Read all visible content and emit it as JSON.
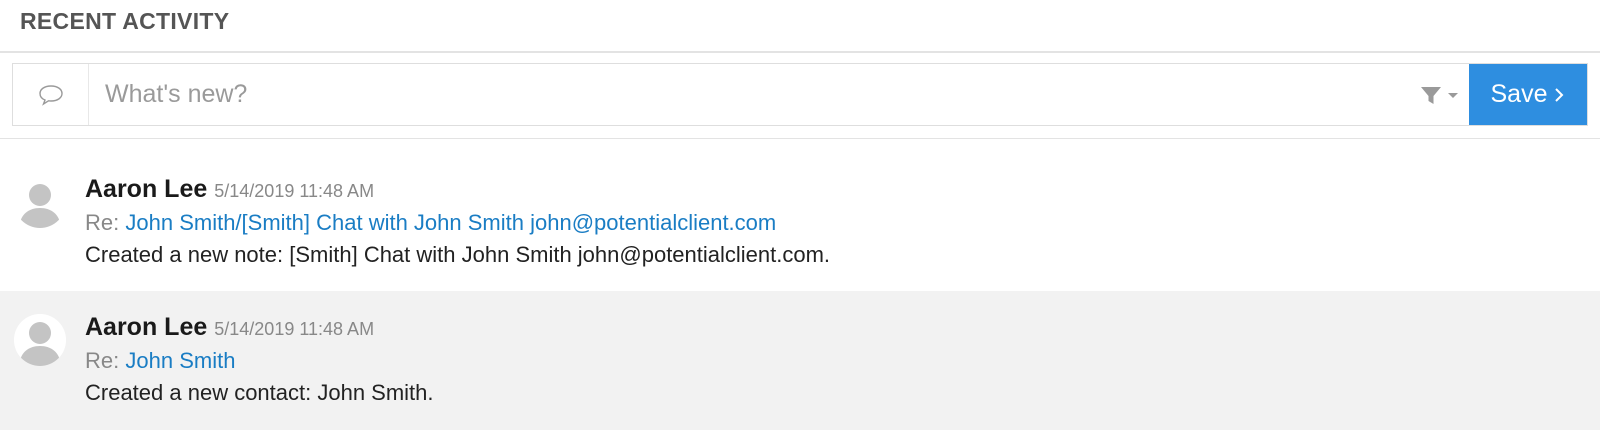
{
  "header": {
    "title": "RECENT ACTIVITY"
  },
  "composer": {
    "icon": "speech-bubble-icon",
    "placeholder": "What's new?",
    "filter_icon": "filter-icon",
    "save_label": "Save",
    "save_icon": "chevron-right-icon",
    "save_color": "#2e8ee0"
  },
  "activities": [
    {
      "author": "Aaron Lee",
      "timestamp": "5/14/2019 11:48 AM",
      "re_prefix": "Re:",
      "re_link": "John Smith/[Smith] Chat with John Smith john@potentialclient.com",
      "message": "Created a new note: [Smith] Chat with John Smith john@potentialclient.com."
    },
    {
      "author": "Aaron Lee",
      "timestamp": "5/14/2019 11:48 AM",
      "re_prefix": "Re:",
      "re_link": "John Smith",
      "message": "Created a new contact: John Smith."
    }
  ],
  "colors": {
    "link": "#1a7dc4",
    "alt_row": "#f2f2f2",
    "accent": "#2e8ee0"
  }
}
